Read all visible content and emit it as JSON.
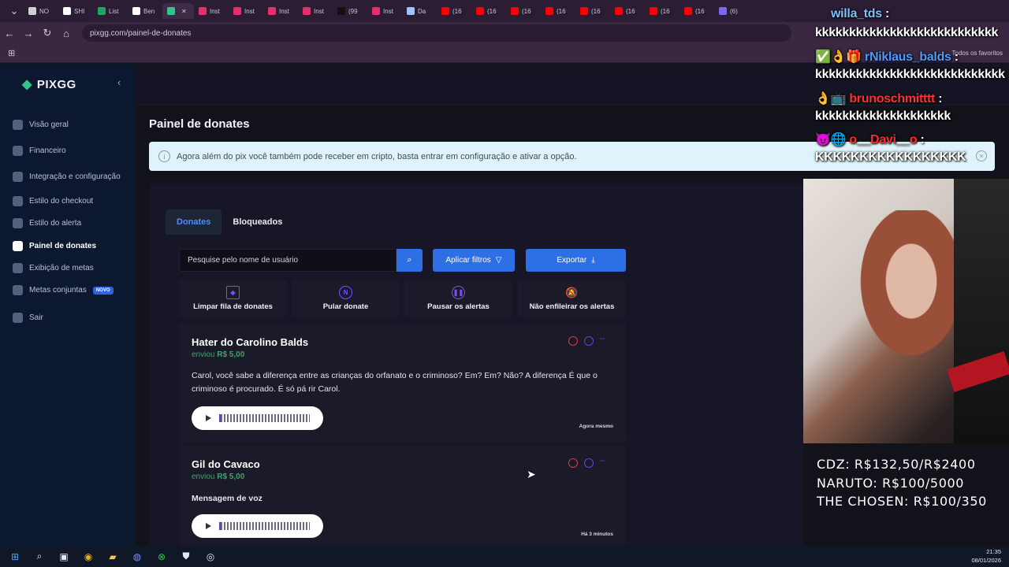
{
  "browser": {
    "tabs": [
      {
        "label": "NO",
        "color": "#d0d0d0"
      },
      {
        "label": "SHI",
        "color": "#ffffff"
      },
      {
        "label": "List",
        "color": "#1fa463"
      },
      {
        "label": "Ben",
        "color": "#ffffff"
      },
      {
        "label": "",
        "color": "#33c48a",
        "active": true
      },
      {
        "label": "Inst",
        "color": "#e1306c"
      },
      {
        "label": "Inst",
        "color": "#e1306c"
      },
      {
        "label": "Inst",
        "color": "#e1306c"
      },
      {
        "label": "Inst",
        "color": "#e1306c"
      },
      {
        "label": "(99",
        "color": "#111111"
      },
      {
        "label": "Inst",
        "color": "#e1306c"
      },
      {
        "label": "Da",
        "color": "#9ec3ff"
      },
      {
        "label": "(16",
        "color": "#ff0000"
      },
      {
        "label": "(16",
        "color": "#ff0000"
      },
      {
        "label": "(16",
        "color": "#ff0000"
      },
      {
        "label": "(16",
        "color": "#ff0000"
      },
      {
        "label": "(16",
        "color": "#ff0000"
      },
      {
        "label": "(16",
        "color": "#ff0000"
      },
      {
        "label": "(16",
        "color": "#ff0000"
      },
      {
        "label": "(16",
        "color": "#ff0000"
      },
      {
        "label": "(6)",
        "color": "#7b68ee"
      }
    ],
    "url": "pixgg.com/painel-de-donates",
    "favorites_label": "Todos os favoritos"
  },
  "sidebar": {
    "brand": "PIXGG",
    "items": [
      {
        "label": "Visão geral"
      },
      {
        "label": "Financeiro"
      },
      {
        "label": "Integração e configuração"
      },
      {
        "label": "Estilo do checkout"
      },
      {
        "label": "Estilo do alerta"
      },
      {
        "label": "Painel de donates",
        "active": true
      },
      {
        "label": "Exibição de metas"
      },
      {
        "label": "Metas conjuntas",
        "badge": "NOVO"
      },
      {
        "label": "Sair"
      }
    ]
  },
  "main": {
    "title": "Painel de donates",
    "info": "Agora além do pix você também pode receber em cripto, basta entrar em configuração e ativar a opção.",
    "tabs": [
      "Donates",
      "Bloqueados"
    ],
    "search_placeholder": "Pesquise pelo nome de usuário",
    "filter_label": "Aplicar filtros",
    "export_label": "Exportar",
    "actions": [
      "Limpar fila de donates",
      "Pular donate",
      "Pausar os alertas",
      "Não enfileirar os alertas"
    ],
    "donates": [
      {
        "name": "Hater do Carolino Balds",
        "sent": "enviou",
        "amount": "R$ 5,00",
        "message": "Carol, você sabe a diferença entre as crianças do orfanato e o criminoso? Em? Em? Não? A diferença É que o criminoso é procurado. É só pá rir Carol.",
        "time": "Agora mesmo"
      },
      {
        "name": "Gil do Cavaco",
        "sent": "enviou",
        "amount": "R$ 5,00",
        "message": "Mensagem de voz",
        "time": "Há 3 minutos"
      }
    ]
  },
  "stream": {
    "chat": [
      {
        "user": "willa_tds",
        "text": "kkkkkkkkkkkkkkkkkkkkkkkkkkk",
        "user_color": "#7ac3ff"
      },
      {
        "user": "rNiklaus_balds",
        "text": "kkkkkkkkkkkkkkkkkkkkkkkkkkkk",
        "user_color": "#4d9bff"
      },
      {
        "user": "brunoschmitttt",
        "text": "kkkkkkkkkkkkkkkkkkkk",
        "user_color": "#ff3030"
      },
      {
        "user": "o__Davi__o",
        "text": "KKKKKKKKKKKKKKKKK",
        "user_color": "#ff2a2a"
      }
    ],
    "goals": [
      "CDZ: R$132,50/R$2400",
      "NARUTO: R$100/5000",
      "THE CHOSEN: R$100/350"
    ]
  },
  "taskbar": {
    "time": "21:35",
    "date": "08/01/2026"
  }
}
